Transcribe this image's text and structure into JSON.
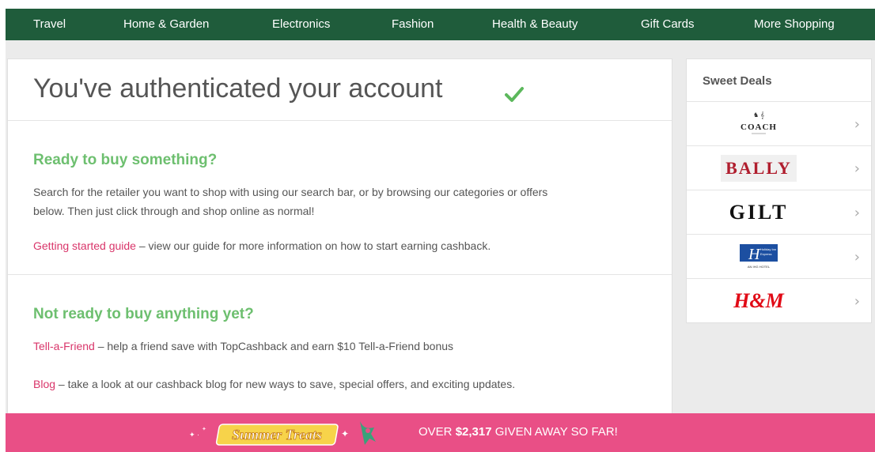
{
  "nav": {
    "items": [
      "Travel",
      "Home & Garden",
      "Electronics",
      "Fashion",
      "Health & Beauty",
      "Gift Cards",
      "More Shopping"
    ]
  },
  "main": {
    "title": "You've authenticated your account",
    "ready": {
      "heading": "Ready to buy something?",
      "line1": "Search for the retailer you want to shop with using our search bar, or by browsing our categories or offers",
      "line2": "below. Then just click through and shop online as normal!",
      "guide_link": "Getting started guide",
      "guide_text": " – view our guide for more information on how to start earning cashback."
    },
    "not_ready": {
      "heading": "Not ready to buy anything yet?",
      "taf_link": "Tell-a-Friend",
      "taf_text": " – help a friend save with TopCashback and earn $10 Tell-a-Friend bonus",
      "blog_link": "Blog",
      "blog_text": " – take a look at our cashback blog for new ways to save, special offers, and exciting updates."
    }
  },
  "deals": {
    "title": "Sweet Deals",
    "items": [
      {
        "brand": "COACH",
        "icon": "coach-logo"
      },
      {
        "brand": "BALLY",
        "icon": "bally-logo"
      },
      {
        "brand": "GILT",
        "icon": "gilt-logo"
      },
      {
        "brand": "Holiday Inn Express",
        "icon": "holiday-inn-express-logo",
        "sub": "AN IHG HOTEL"
      },
      {
        "brand": "H&M",
        "icon": "hm-logo"
      }
    ]
  },
  "banner": {
    "logo": "Summer Treats",
    "prefix": "OVER ",
    "amount": "$2,317",
    "suffix": " GIVEN AWAY SO FAR!"
  },
  "colors": {
    "nav_bg": "#1f5c3b",
    "heading_green": "#6dbf6f",
    "link_pink": "#d9356a",
    "banner_pink": "#e94f86"
  }
}
